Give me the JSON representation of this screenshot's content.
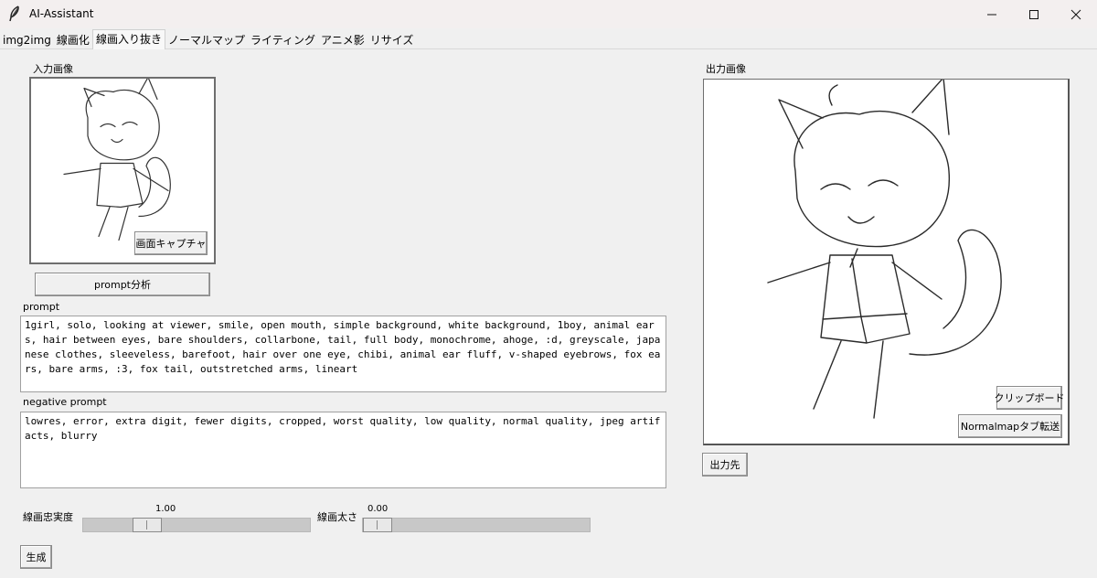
{
  "window": {
    "title": "AI-Assistant"
  },
  "tabs": [
    "img2img",
    "線画化",
    "線画入り抜き",
    "ノーマルマップ",
    "ライティング",
    "アニメ影",
    "リサイズ"
  ],
  "active_tab_index": 2,
  "input_panel": {
    "label": "入力画像",
    "capture_button": "画面キャプチャ"
  },
  "prompt_analyze_button": "prompt分析",
  "prompt": {
    "label": "prompt",
    "value": "1girl, solo, looking at viewer, smile, open mouth, simple background, white background, 1boy, animal ears, hair between eyes, bare shoulders, collarbone, tail, full body, monochrome, ahoge, :d, greyscale, japanese clothes, sleeveless, barefoot, hair over one eye, chibi, animal ear fluff, v-shaped eyebrows, fox ears, bare arms, :3, fox tail, outstretched arms, lineart"
  },
  "negative_prompt": {
    "label": "negative prompt",
    "value": "lowres, error, extra digit, fewer digits, cropped, worst quality, low quality, normal quality, jpeg artifacts, blurry"
  },
  "sliders": {
    "fidelity": {
      "label": "線画忠実度",
      "value": "1.00",
      "level": 0.25
    },
    "thickness": {
      "label": "線画太さ",
      "value": "0.00",
      "level": 0.0
    }
  },
  "generate_button": "生成",
  "output_panel": {
    "label": "出力画像",
    "clipboard_button": "クリップボード",
    "normalmap_button": "Normalmapタブ転送",
    "output_dest_button": "出力先"
  },
  "icons": {
    "app": "feather-icon",
    "minimize": "minimize-icon",
    "maximize": "maximize-icon",
    "close": "close-icon"
  }
}
